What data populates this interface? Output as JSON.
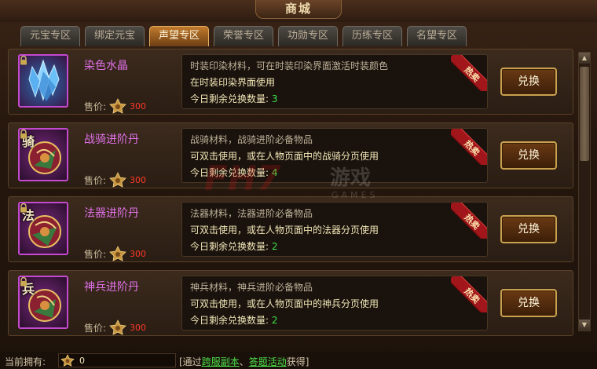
{
  "window": {
    "title": "商城"
  },
  "tabs": [
    {
      "label": "元宝专区",
      "active": false
    },
    {
      "label": "绑定元宝",
      "active": false
    },
    {
      "label": "声望专区",
      "active": true
    },
    {
      "label": "荣誉专区",
      "active": false
    },
    {
      "label": "功勋专区",
      "active": false
    },
    {
      "label": "历练专区",
      "active": false
    },
    {
      "label": "名望专区",
      "active": false
    }
  ],
  "items": [
    {
      "name": "染色水晶",
      "icon": "crystal-icon",
      "icon_char": "",
      "price_label": "售价:",
      "price": "300",
      "desc1": "时装印染材料，可在时装印染界面激活时装颜色",
      "desc2": "在时装印染界面使用",
      "remain_label": "今日剩余兑换数量:",
      "remain": "3",
      "ribbon": "热卖",
      "button": "兑换"
    },
    {
      "name": "战骑进阶丹",
      "icon": "mount-pill-icon",
      "icon_char": "骑",
      "price_label": "售价:",
      "price": "300",
      "desc1": "战骑材料，战骑进阶必备物品",
      "desc2": "可双击使用，或在人物页面中的战骑分页使用",
      "remain_label": "今日剩余兑换数量:",
      "remain": "4",
      "ribbon": "热卖",
      "button": "兑换"
    },
    {
      "name": "法器进阶丹",
      "icon": "artifact-pill-icon",
      "icon_char": "法",
      "price_label": "售价:",
      "price": "300",
      "desc1": "法器材料，法器进阶必备物品",
      "desc2": "可双击使用，或在人物页面中的法器分页使用",
      "remain_label": "今日剩余兑换数量:",
      "remain": "2",
      "ribbon": "热卖",
      "button": "兑换"
    },
    {
      "name": "神兵进阶丹",
      "icon": "weapon-pill-icon",
      "icon_char": "兵",
      "price_label": "售价:",
      "price": "300",
      "desc1": "神兵材料，神兵进阶必备物品",
      "desc2": "可双击使用，或在人物页面中的神兵分页使用",
      "remain_label": "今日剩余兑换数量:",
      "remain": "2",
      "ribbon": "热卖",
      "button": "兑换"
    }
  ],
  "footer": {
    "owned_label": "当前拥有:",
    "owned_value": "0",
    "hint_prefix": "[通过",
    "hint_link1": "跨服副本",
    "hint_sep": "、",
    "hint_link2": "答题活动",
    "hint_suffix": "获得]"
  },
  "watermark": {
    "logo": "FH7",
    "cn": "游戏",
    "en": "GAMES"
  },
  "colors": {
    "item_name": "#e070e8",
    "price_value": "#ff3a2a",
    "remain_count": "#3de04a",
    "link": "#4de04a",
    "active_tab": "#c07a2c"
  }
}
